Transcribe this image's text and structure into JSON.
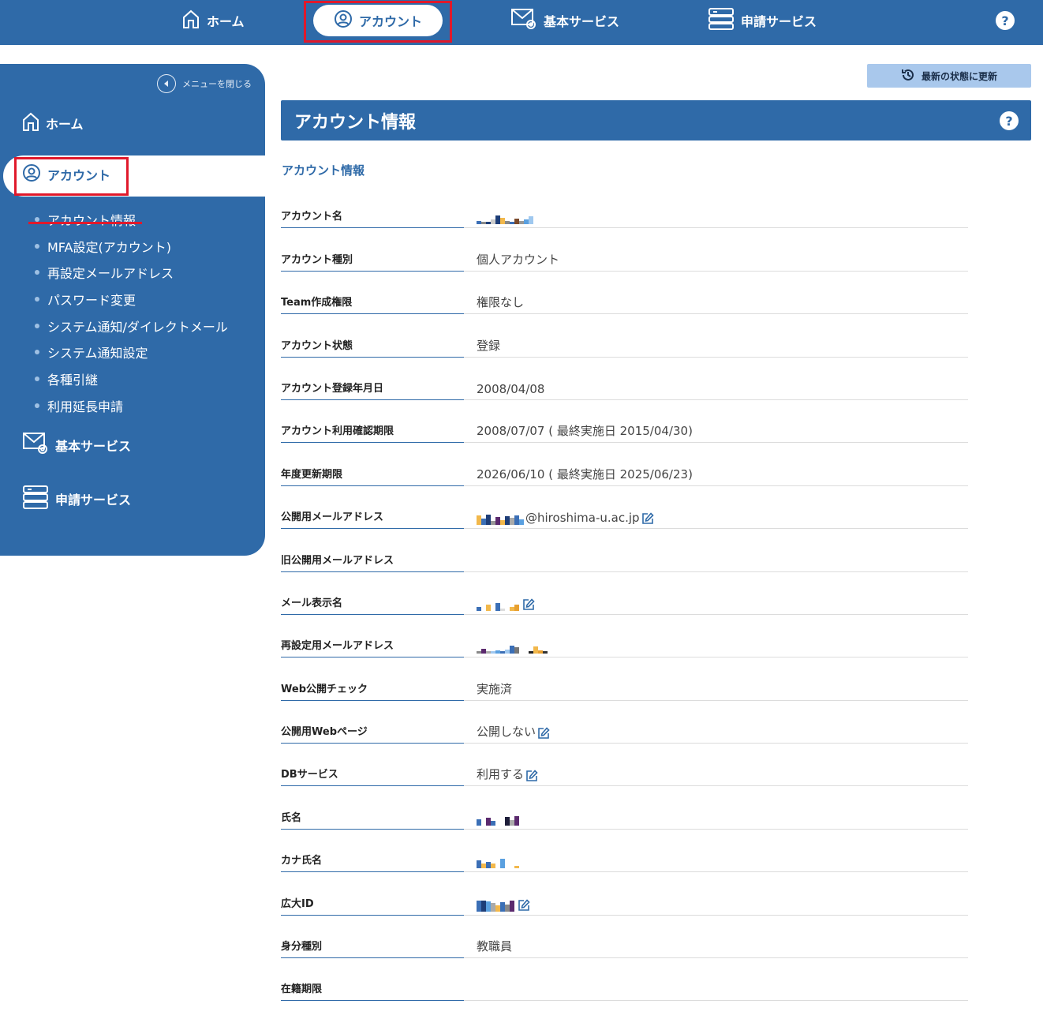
{
  "topnav": {
    "home": "ホーム",
    "account": "アカウント",
    "basic_services": "基本サービス",
    "apply_services": "申請サービス",
    "help": "?"
  },
  "sidebar": {
    "close_menu": "メニューを閉じる",
    "home": "ホーム",
    "account": "アカウント",
    "sub_items": [
      "アカウント情報",
      "MFA設定(アカウント)",
      "再設定メールアドレス",
      "パスワード変更",
      "システム通知/ダイレクトメール",
      "システム通知設定",
      "各種引継",
      "利用延長申請"
    ],
    "basic_services": "基本サービス",
    "apply_services": "申請サービス"
  },
  "refresh_button": "最新の状態に更新",
  "panel": {
    "title": "アカウント情報",
    "help": "?",
    "section_title": "アカウント情報"
  },
  "fields": [
    {
      "label": "アカウント名",
      "value": ""
    },
    {
      "label": "アカウント種別",
      "value": "個人アカウント"
    },
    {
      "label": "Team作成権限",
      "value": "権限なし"
    },
    {
      "label": "アカウント状態",
      "value": "登録"
    },
    {
      "label": "アカウント登録年月日",
      "value": "2008/04/08"
    },
    {
      "label": "アカウント利用確認期限",
      "value": "2008/07/07 ( 最終実施日 2015/04/30)"
    },
    {
      "label": "年度更新期限",
      "value": "2026/06/10 ( 最終実施日 2025/06/23)"
    },
    {
      "label": "公開用メールアドレス",
      "value": "@hiroshima-u.ac.jp"
    },
    {
      "label": "旧公開用メールアドレス",
      "value": ""
    },
    {
      "label": "メール表示名",
      "value": ""
    },
    {
      "label": "再設定用メールアドレス",
      "value": ""
    },
    {
      "label": "Web公開チェック",
      "value": "実施済"
    },
    {
      "label": "公開用Webページ",
      "value": "公開しない"
    },
    {
      "label": "DBサービス",
      "value": "利用する"
    },
    {
      "label": "氏名",
      "value": ""
    },
    {
      "label": "カナ氏名",
      "value": ""
    },
    {
      "label": "広大ID",
      "value": ""
    },
    {
      "label": "身分種別",
      "value": "教職員"
    },
    {
      "label": "在籍期限",
      "value": ""
    }
  ]
}
